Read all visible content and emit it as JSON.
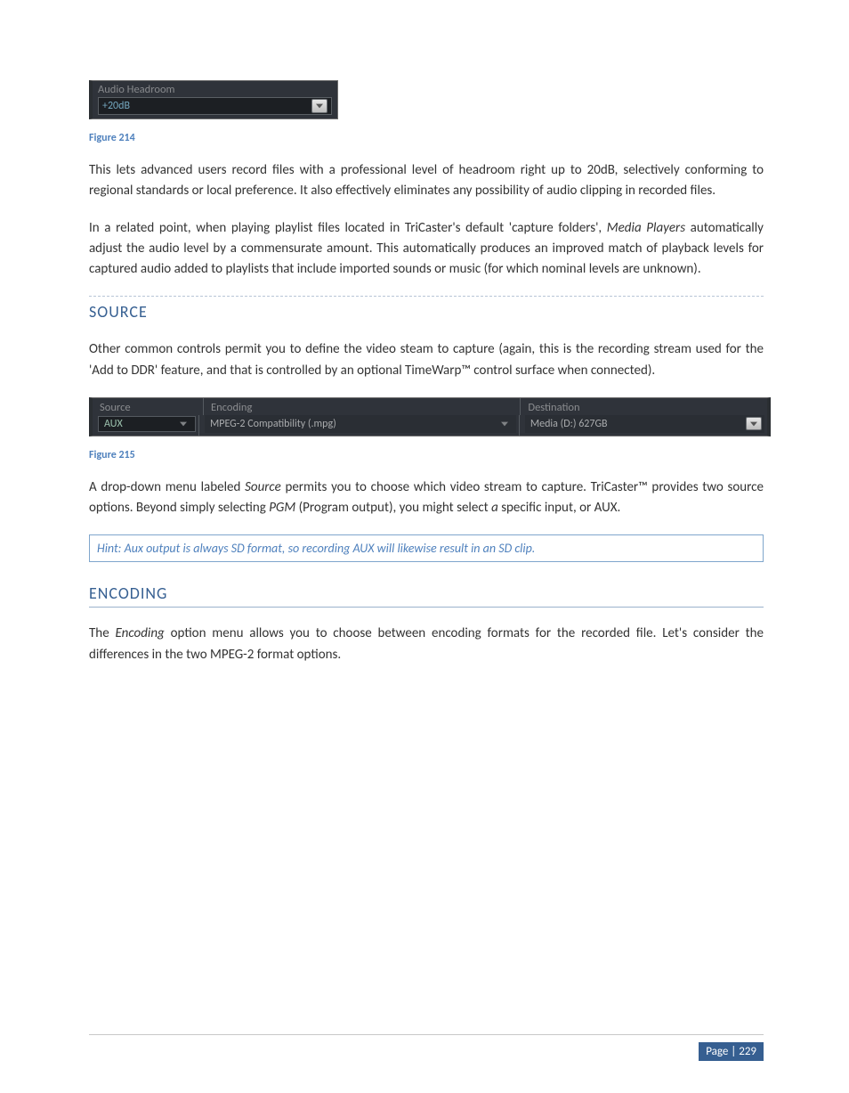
{
  "fig214": {
    "label": "Audio Headroom",
    "value": "+20dB",
    "caption": "Figure 214"
  },
  "para1": "This lets advanced users record files with a professional level of headroom right up to 20dB, selectively conforming to regional standards or local preference.  It also effectively eliminates any possibility of audio clipping in recorded files.",
  "para2_a": "In a related point, when playing playlist files located in TriCaster's default 'capture folders', ",
  "para2_em": "Media Players",
  "para2_b": " automatically adjust the audio level by a commensurate amount.  This automatically produces an improved match of playback levels for captured audio added to playlists that include imported sounds or music (for which nominal levels are unknown).",
  "heading_source": "SOURCE",
  "para3": "Other common controls permit you to define the video steam to capture (again, this is the recording stream used for the 'Add to DDR' feature, and that is controlled by an optional TimeWarp™ control surface when connected).",
  "fig215": {
    "headers": {
      "source": "Source",
      "encoding": "Encoding",
      "destination": "Destination"
    },
    "row": {
      "source": "AUX",
      "encoding": "MPEG-2 Compatibility (.mpg)",
      "destination": "Media (D:) 627GB"
    },
    "caption": "Figure 215"
  },
  "para4_a": "A drop-down menu labeled ",
  "para4_em1": "Source",
  "para4_b": " permits you to choose which video stream to capture.  TriCaster™ provides two source options.  Beyond simply selecting ",
  "para4_em2": "PGM",
  "para4_c": " (Program output), you might select ",
  "para4_em3": "a",
  "para4_d": " specific input, or AUX.",
  "hint": "Hint: Aux output is always SD format, so recording AUX will likewise result in an SD clip.",
  "heading_encoding": "ENCODING",
  "para5_a": "The ",
  "para5_em": "Encoding",
  "para5_b": " option menu allows you to choose between encoding formats for the recorded file.  Let's consider the differences in the two MPEG-2 format options.",
  "page_label": "Page | 229"
}
